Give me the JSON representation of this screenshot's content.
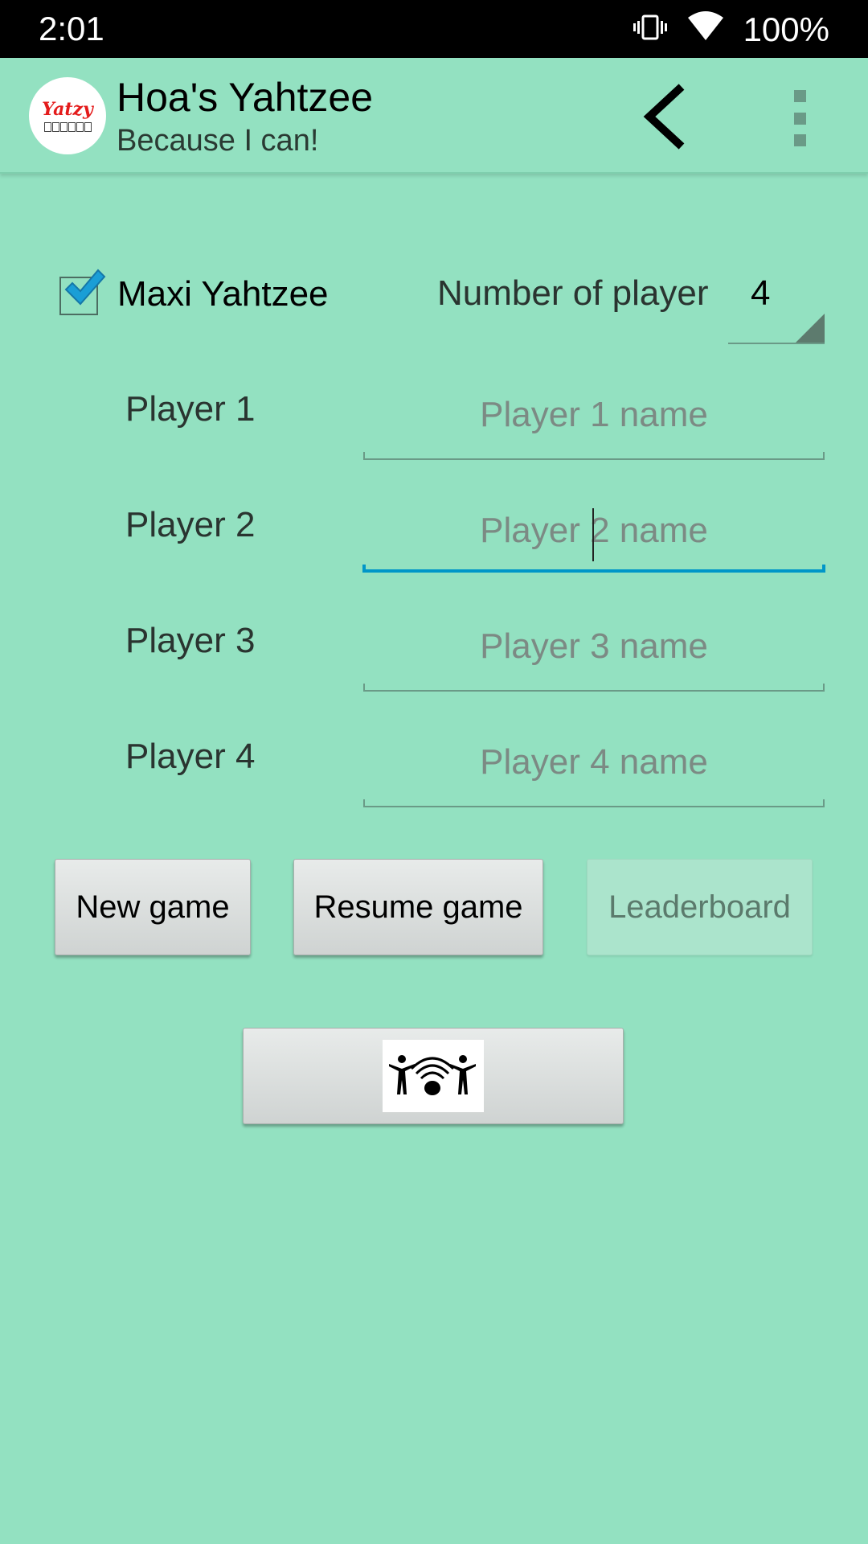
{
  "status_bar": {
    "time": "2:01",
    "battery": "100%",
    "icons": [
      "vibrate-icon",
      "wifi-icon"
    ]
  },
  "app_bar": {
    "logo_text": "Yatzy",
    "title": "Hoa's Yahtzee",
    "subtitle": "Because I can!",
    "actions": [
      "back-icon",
      "overflow-menu-icon"
    ]
  },
  "options": {
    "maxi_label": "Maxi Yahtzee",
    "maxi_checked": true,
    "num_players_label": "Number of player",
    "num_players_value": "4"
  },
  "players": [
    {
      "label": "Player 1",
      "placeholder": "Player 1 name",
      "value": ""
    },
    {
      "label": "Player 2",
      "placeholder": "Player 2 name",
      "value": "",
      "focused": true
    },
    {
      "label": "Player 3",
      "placeholder": "Player 3 name",
      "value": ""
    },
    {
      "label": "Player 4",
      "placeholder": "Player 4 name",
      "value": ""
    }
  ],
  "buttons": {
    "new_game": "New game",
    "resume_game": "Resume game",
    "leaderboard": "Leaderboard",
    "leaderboard_enabled": false
  },
  "share_button": {
    "icon": "people-wireless-icon"
  },
  "colors": {
    "background": "#93e1c1",
    "accent": "#0096c8",
    "logo_red": "#e41b1b"
  }
}
